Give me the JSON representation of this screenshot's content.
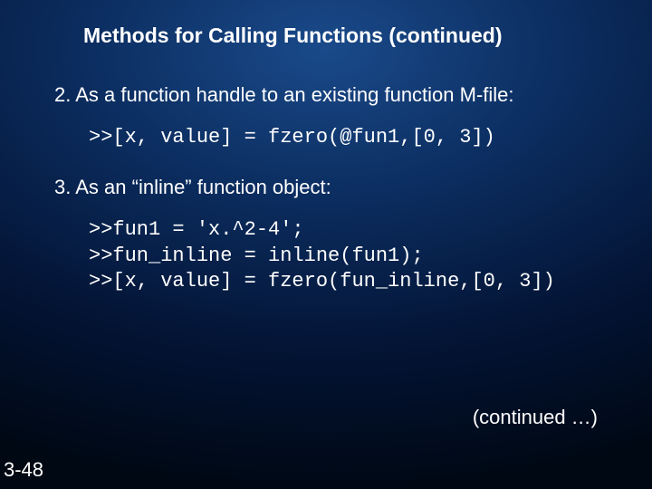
{
  "title": "Methods for Calling Functions (continued)",
  "items": [
    {
      "label": "2.  As a function handle to an existing function M-file:",
      "code": ">>[x, value] = fzero(@fun1,[0, 3])"
    },
    {
      "label": "3.  As an “inline” function object:",
      "code": ">>fun1 = 'x.^2-4';\n>>fun_inline = inline(fun1);\n>>[x, value] = fzero(fun_inline,[0, 3])"
    }
  ],
  "continued": "(continued …)",
  "page_number": "3-48"
}
